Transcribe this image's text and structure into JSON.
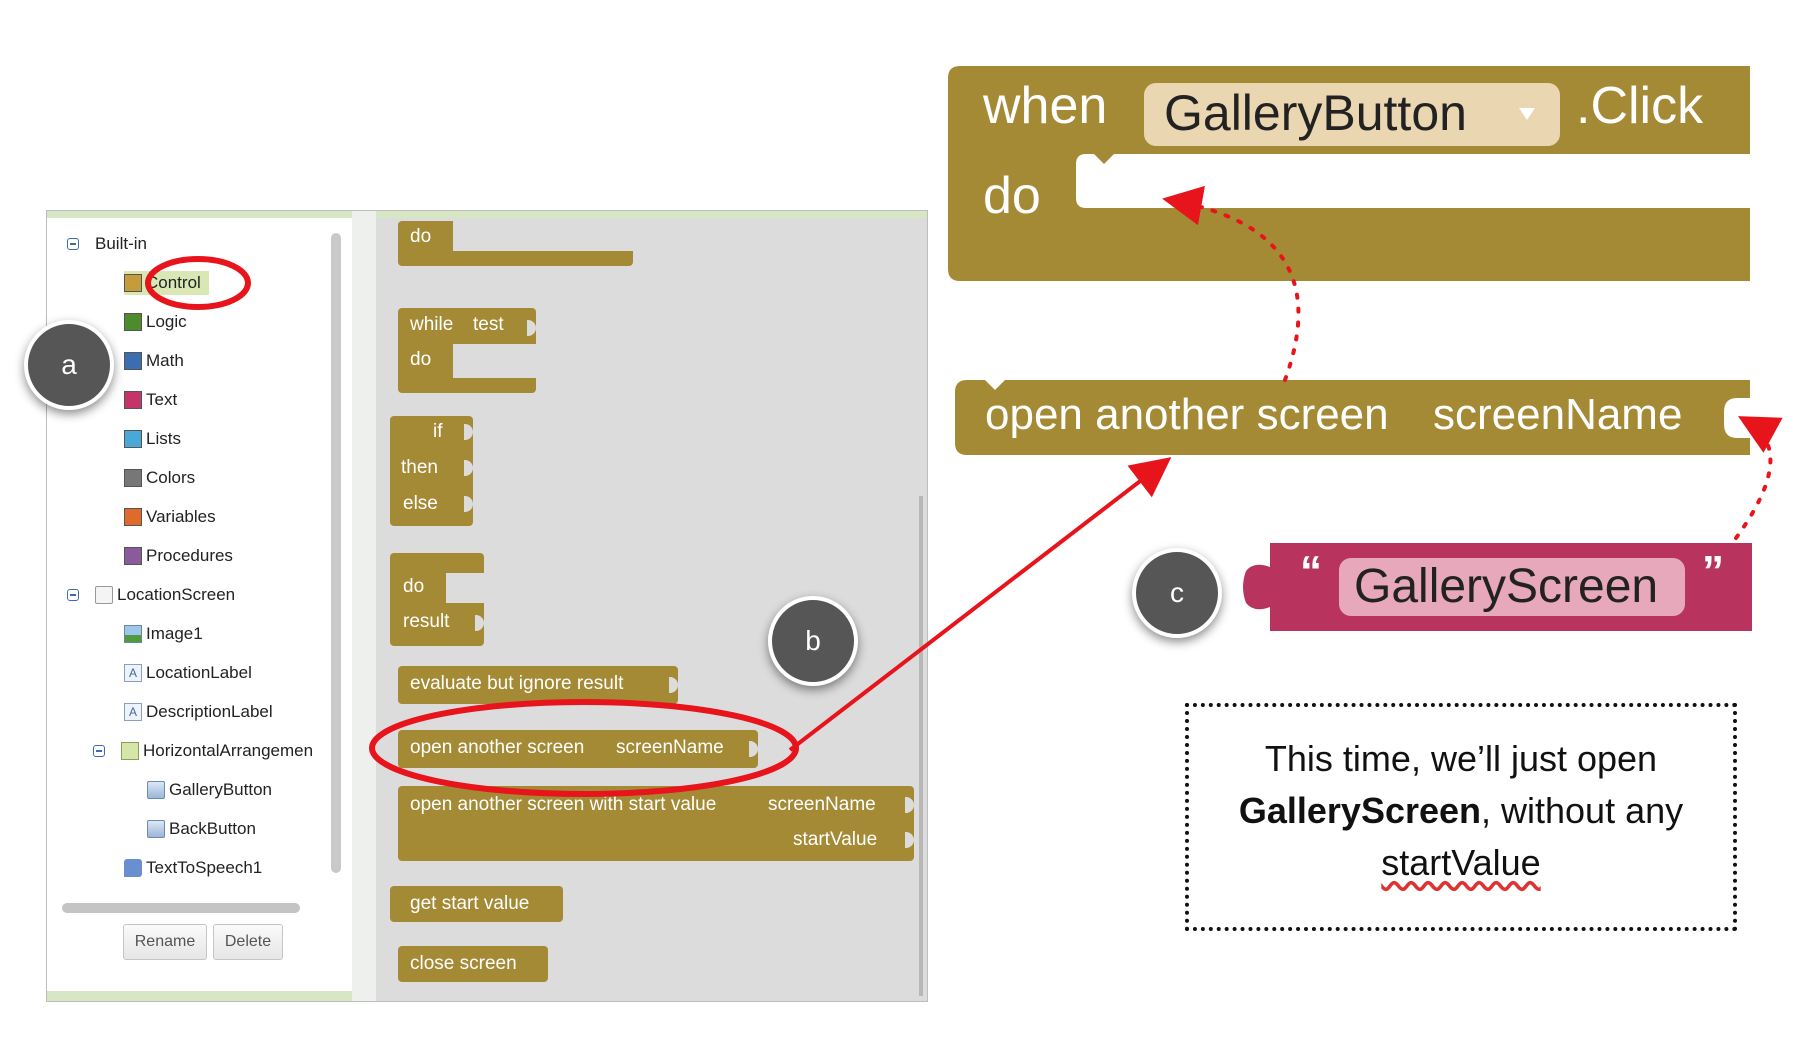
{
  "tree": {
    "builtin_label": "Built-in",
    "builtin_items": [
      {
        "label": "Control",
        "color": "#c59b3c"
      },
      {
        "label": "Logic",
        "color": "#4c8c2c"
      },
      {
        "label": "Math",
        "color": "#3b6db2"
      },
      {
        "label": "Text",
        "color": "#c63369"
      },
      {
        "label": "Lists",
        "color": "#4aa8d8"
      },
      {
        "label": "Colors",
        "color": "#777777"
      },
      {
        "label": "Variables",
        "color": "#e0692c"
      },
      {
        "label": "Procedures",
        "color": "#8a5a9c"
      }
    ],
    "screen_label": "LocationScreen",
    "components": {
      "image1": "Image1",
      "location_label": "LocationLabel",
      "description_label": "DescriptionLabel",
      "horizontal_arrangement": "HorizontalArrangemen",
      "gallery_button": "GalleryButton",
      "back_button": "BackButton",
      "text_to_speech": "TextToSpeech1"
    },
    "rename_label": "Rename",
    "delete_label": "Delete"
  },
  "blocks": {
    "do_label": "do",
    "while_label": "while",
    "test_label": "test",
    "if_label": "if",
    "then_label": "then",
    "else_label": "else",
    "result_label": "result",
    "evaluate": "evaluate but ignore result",
    "open_screen": "open another screen",
    "screen_name": "screenName",
    "open_screen_with_value": "open another screen with start value",
    "start_value": "startValue",
    "get_start_value": "get start value",
    "close_screen": "close screen",
    "block_color": "#a58a36"
  },
  "zoomed": {
    "when": "when",
    "component": "GalleryButton",
    "event": ".Click",
    "do": "do",
    "open_screen": "open another screen",
    "screen_name": "screenName",
    "open_quote": "“",
    "string_value": "GalleryScreen",
    "close_quote": "”",
    "text_block_color": "#b8345f"
  },
  "badges": {
    "a": "a",
    "b": "b",
    "c": "c"
  },
  "note": {
    "line1": "This time, we’ll just open",
    "bold": "GalleryScreen",
    "line2_rest": ", without any",
    "line3": "startValue"
  },
  "colors": {
    "highlight_red": "#e8141c"
  }
}
